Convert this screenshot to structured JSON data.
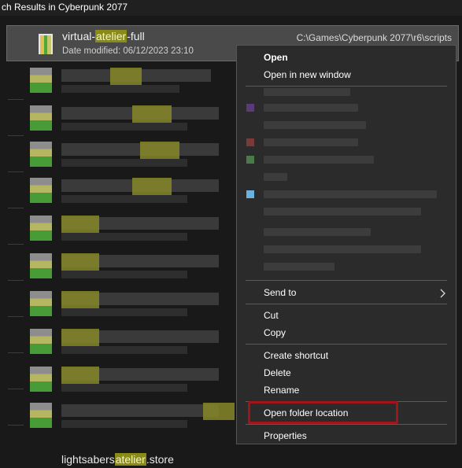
{
  "window": {
    "title": "ch Results in Cyberpunk 2077"
  },
  "selected_file": {
    "name_pre": "virtual-",
    "name_match": "atelier",
    "name_post": "-full",
    "date_modified": "Date modified: 06/12/2023 23:10",
    "path": "C:\\Games\\Cyberpunk 2077\\r6\\scripts"
  },
  "context_menu": {
    "open": "Open",
    "open_new_window": "Open in new window",
    "send_to": "Send to",
    "cut": "Cut",
    "copy": "Copy",
    "create_shortcut": "Create shortcut",
    "delete": "Delete",
    "rename": "Rename",
    "open_folder_location": "Open folder location",
    "properties": "Properties"
  },
  "bottom_file": {
    "name_pre": "lightsabers",
    "name_match": "atelier",
    "name_post": ".store"
  },
  "colors": {
    "highlight_border": "#a0141a",
    "match_highlight": "#8a8a18"
  }
}
